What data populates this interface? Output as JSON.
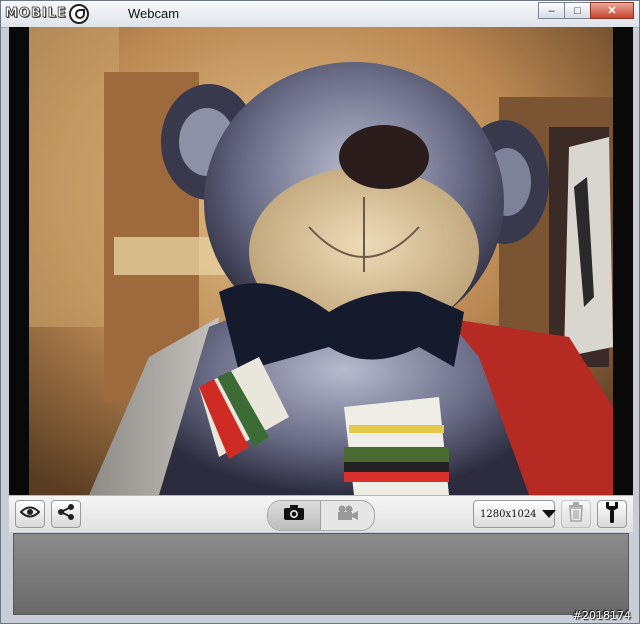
{
  "window": {
    "logo_text": "MOBILE",
    "title": "Webcam",
    "controls": {
      "minimize": "–",
      "maximize": "□",
      "close": "✕"
    }
  },
  "viewport": {
    "scene": "webcam-live-preview",
    "subject": "plush teddy bear with bow tie and striped scarf"
  },
  "toolbar": {
    "left_icons": [
      "eye-icon",
      "share-icon"
    ],
    "capture_modes": [
      {
        "icon": "camera-icon",
        "active": true
      },
      {
        "icon": "video-camera-icon",
        "active": false
      }
    ],
    "resolution": "1280x1024",
    "right_icons": [
      "trash-icon",
      "wrench-icon"
    ]
  },
  "watermark": "#2018174"
}
